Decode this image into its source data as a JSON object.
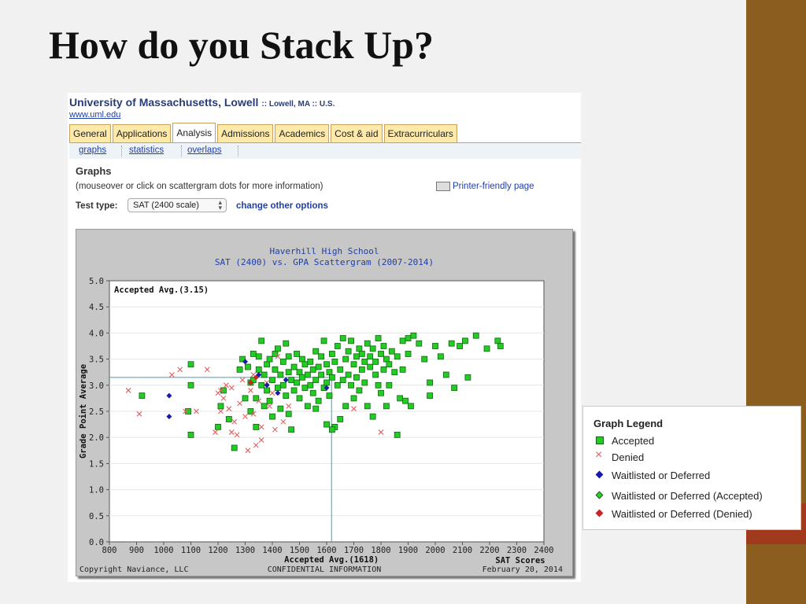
{
  "slide": {
    "title": "How do you Stack Up?"
  },
  "header": {
    "university": "University of Massachusetts, Lowell",
    "location": ":: Lowell, MA :: U.S.",
    "url": "www.uml.edu"
  },
  "tabs": [
    {
      "label": "General"
    },
    {
      "label": "Applications"
    },
    {
      "label": "Analysis",
      "active": true
    },
    {
      "label": "Admissions"
    },
    {
      "label": "Academics"
    },
    {
      "label": "Cost & aid"
    },
    {
      "label": "Extracurriculars"
    }
  ],
  "subnav": [
    "graphs",
    "statistics",
    "overlaps"
  ],
  "graphs": {
    "heading": "Graphs",
    "note": "(mouseover or click on scattergram dots for more information)",
    "printer": "Printer-friendly page",
    "test_label": "Test type:",
    "test_value": "SAT (2400 scale)",
    "change_options": "change other options"
  },
  "colors": {
    "accepted": "#22cc22",
    "denied": "#e06060",
    "waitlisted": "#1a1aa8",
    "waitlisted_accepted": "#33cc33",
    "waitlisted_denied": "#cc2222",
    "avg_line": "#4a9ab8",
    "chart_title": "#1f3fa8"
  },
  "chart_data": {
    "type": "scatter",
    "title": "Haverhill High School",
    "subtitle": "SAT (2400) vs. GPA Scattergram (2007-2014)",
    "xlabel": "SAT Scores",
    "ylabel": "Grade Point Average",
    "xlim": [
      800,
      2400
    ],
    "ylim": [
      0.0,
      5.0
    ],
    "xticks": [
      800,
      900,
      1000,
      1100,
      1200,
      1300,
      1400,
      1500,
      1600,
      1700,
      1800,
      1900,
      2000,
      2100,
      2200,
      2300,
      2400
    ],
    "yticks": [
      "0.0",
      "0.5",
      "1.0",
      "1.5",
      "2.0",
      "2.5",
      "3.0",
      "3.5",
      "4.0",
      "4.5",
      "5.0"
    ],
    "grid": true,
    "accepted_avg_x": 1618,
    "accepted_avg_y": 3.15,
    "accepted_avg_x_label": "Accepted Avg.(1618)",
    "accepted_avg_y_label": "Accepted Avg.(3.15)",
    "footer_left": "Copyright Naviance, LLC",
    "footer_center": "CONFIDENTIAL INFORMATION",
    "footer_right": "February 20, 2014",
    "series": [
      {
        "name": "Accepted",
        "marker": "square",
        "points": [
          [
            920,
            2.8
          ],
          [
            1100,
            3.4
          ],
          [
            1100,
            3.0
          ],
          [
            1100,
            2.05
          ],
          [
            1090,
            2.5
          ],
          [
            1200,
            2.2
          ],
          [
            1210,
            2.6
          ],
          [
            1220,
            2.9
          ],
          [
            1240,
            2.35
          ],
          [
            1260,
            1.8
          ],
          [
            1280,
            3.3
          ],
          [
            1290,
            3.5
          ],
          [
            1300,
            2.75
          ],
          [
            1310,
            3.35
          ],
          [
            1320,
            2.5
          ],
          [
            1320,
            3.05
          ],
          [
            1330,
            3.1
          ],
          [
            1330,
            3.6
          ],
          [
            1340,
            2.2
          ],
          [
            1340,
            2.75
          ],
          [
            1350,
            3.55
          ],
          [
            1350,
            3.3
          ],
          [
            1360,
            3.85
          ],
          [
            1360,
            3.0
          ],
          [
            1370,
            2.6
          ],
          [
            1370,
            3.2
          ],
          [
            1380,
            2.9
          ],
          [
            1380,
            3.4
          ],
          [
            1390,
            3.5
          ],
          [
            1390,
            2.7
          ],
          [
            1400,
            3.1
          ],
          [
            1400,
            2.4
          ],
          [
            1410,
            3.3
          ],
          [
            1410,
            3.6
          ],
          [
            1420,
            2.95
          ],
          [
            1420,
            3.7
          ],
          [
            1430,
            3.2
          ],
          [
            1430,
            2.55
          ],
          [
            1440,
            3.45
          ],
          [
            1440,
            3.0
          ],
          [
            1450,
            3.8
          ],
          [
            1450,
            2.8
          ],
          [
            1460,
            3.25
          ],
          [
            1460,
            3.55
          ],
          [
            1470,
            2.15
          ],
          [
            1470,
            3.1
          ],
          [
            1480,
            3.35
          ],
          [
            1480,
            2.9
          ],
          [
            1490,
            3.6
          ],
          [
            1490,
            3.05
          ],
          [
            1500,
            3.25
          ],
          [
            1500,
            2.75
          ],
          [
            1510,
            3.5
          ],
          [
            1510,
            3.15
          ],
          [
            1520,
            2.95
          ],
          [
            1520,
            3.4
          ],
          [
            1530,
            3.2
          ],
          [
            1530,
            2.6
          ],
          [
            1540,
            3.45
          ],
          [
            1540,
            3.0
          ],
          [
            1550,
            3.3
          ],
          [
            1550,
            2.85
          ],
          [
            1560,
            3.65
          ],
          [
            1560,
            3.1
          ],
          [
            1570,
            3.35
          ],
          [
            1570,
            2.7
          ],
          [
            1580,
            3.2
          ],
          [
            1580,
            3.55
          ],
          [
            1590,
            3.85
          ],
          [
            1590,
            2.95
          ],
          [
            1600,
            3.4
          ],
          [
            1600,
            3.05
          ],
          [
            1610,
            3.25
          ],
          [
            1610,
            2.8
          ],
          [
            1620,
            3.6
          ],
          [
            1620,
            3.15
          ],
          [
            1630,
            2.2
          ],
          [
            1630,
            3.45
          ],
          [
            1640,
            3.0
          ],
          [
            1640,
            3.75
          ],
          [
            1650,
            3.3
          ],
          [
            1650,
            2.35
          ],
          [
            1660,
            3.9
          ],
          [
            1660,
            3.1
          ],
          [
            1670,
            3.5
          ],
          [
            1670,
            2.6
          ],
          [
            1680,
            3.2
          ],
          [
            1680,
            3.65
          ],
          [
            1690,
            3.0
          ],
          [
            1690,
            3.85
          ],
          [
            1700,
            3.4
          ],
          [
            1700,
            2.75
          ],
          [
            1710,
            3.55
          ],
          [
            1710,
            3.15
          ],
          [
            1720,
            3.7
          ],
          [
            1720,
            2.9
          ],
          [
            1730,
            3.3
          ],
          [
            1730,
            3.6
          ],
          [
            1740,
            3.45
          ],
          [
            1740,
            3.05
          ],
          [
            1750,
            3.8
          ],
          [
            1750,
            2.6
          ],
          [
            1760,
            3.35
          ],
          [
            1760,
            3.55
          ],
          [
            1770,
            3.7
          ],
          [
            1770,
            2.4
          ],
          [
            1780,
            3.45
          ],
          [
            1780,
            3.2
          ],
          [
            1790,
            3.9
          ],
          [
            1790,
            3.0
          ],
          [
            1800,
            3.6
          ],
          [
            1800,
            2.85
          ],
          [
            1810,
            3.3
          ],
          [
            1810,
            3.75
          ],
          [
            1820,
            3.5
          ],
          [
            1820,
            2.6
          ],
          [
            1830,
            3.4
          ],
          [
            1830,
            3.0
          ],
          [
            1840,
            3.65
          ],
          [
            1850,
            3.25
          ],
          [
            1860,
            2.05
          ],
          [
            1860,
            3.55
          ],
          [
            1870,
            2.75
          ],
          [
            1880,
            3.3
          ],
          [
            1880,
            3.85
          ],
          [
            1890,
            2.7
          ],
          [
            1900,
            3.6
          ],
          [
            1900,
            3.9
          ],
          [
            1910,
            2.6
          ],
          [
            1920,
            3.95
          ],
          [
            1940,
            3.8
          ],
          [
            1960,
            3.5
          ],
          [
            1980,
            2.8
          ],
          [
            1980,
            3.05
          ],
          [
            2000,
            3.75
          ],
          [
            2020,
            3.55
          ],
          [
            2040,
            3.2
          ],
          [
            2060,
            3.8
          ],
          [
            2070,
            2.95
          ],
          [
            2090,
            3.75
          ],
          [
            2110,
            3.85
          ],
          [
            2120,
            3.15
          ],
          [
            2150,
            3.95
          ],
          [
            2190,
            3.7
          ],
          [
            2230,
            3.85
          ],
          [
            2240,
            3.75
          ],
          [
            1600,
            2.25
          ],
          [
            1620,
            2.15
          ],
          [
            1560,
            2.55
          ],
          [
            1460,
            2.45
          ]
        ]
      },
      {
        "name": "Denied",
        "marker": "x",
        "points": [
          [
            870,
            2.9
          ],
          [
            910,
            2.45
          ],
          [
            1030,
            3.2
          ],
          [
            1060,
            3.3
          ],
          [
            1080,
            2.5
          ],
          [
            1120,
            2.5
          ],
          [
            1160,
            3.3
          ],
          [
            1190,
            2.1
          ],
          [
            1200,
            2.85
          ],
          [
            1210,
            2.5
          ],
          [
            1220,
            2.75
          ],
          [
            1230,
            3.0
          ],
          [
            1240,
            2.55
          ],
          [
            1250,
            2.1
          ],
          [
            1260,
            2.3
          ],
          [
            1270,
            2.05
          ],
          [
            1280,
            2.65
          ],
          [
            1290,
            3.1
          ],
          [
            1300,
            2.4
          ],
          [
            1310,
            1.75
          ],
          [
            1320,
            2.9
          ],
          [
            1330,
            2.45
          ],
          [
            1340,
            1.85
          ],
          [
            1350,
            2.7
          ],
          [
            1360,
            2.2
          ],
          [
            1380,
            3.05
          ],
          [
            1390,
            2.6
          ],
          [
            1400,
            2.85
          ],
          [
            1410,
            2.15
          ],
          [
            1420,
            3.55
          ],
          [
            1440,
            2.3
          ],
          [
            1460,
            2.6
          ],
          [
            1700,
            2.55
          ],
          [
            1800,
            2.1
          ],
          [
            1210,
            2.9
          ],
          [
            1250,
            2.95
          ],
          [
            1330,
            3.2
          ],
          [
            1360,
            1.95
          ]
        ]
      },
      {
        "name": "Waitlisted or Deferred",
        "marker": "diamond",
        "points": [
          [
            1020,
            2.4
          ],
          [
            1020,
            2.8
          ],
          [
            1300,
            3.45
          ],
          [
            1380,
            3.0
          ],
          [
            1420,
            2.85
          ],
          [
            1450,
            3.1
          ],
          [
            1600,
            2.95
          ],
          [
            1350,
            3.2
          ]
        ]
      },
      {
        "name": "Waitlisted or Deferred (Accepted)",
        "marker": "diamond",
        "points": []
      },
      {
        "name": "Waitlisted or Deferred (Denied)",
        "marker": "diamond",
        "points": [
          [
            1340,
            3.15
          ],
          [
            1320,
            3.05
          ]
        ]
      }
    ]
  },
  "legend": {
    "title": "Graph Legend",
    "items": [
      {
        "label": "Accepted",
        "icon": "accepted-marker"
      },
      {
        "label": "Denied",
        "icon": "denied-marker"
      },
      {
        "label": "Waitlisted or Deferred",
        "icon": "waitlisted-marker"
      },
      {
        "label": "Waitlisted or Deferred (Accepted)",
        "icon": "waitlisted-accepted-marker"
      },
      {
        "label": "Waitlisted or Deferred (Denied)",
        "icon": "waitlisted-denied-marker"
      }
    ]
  }
}
